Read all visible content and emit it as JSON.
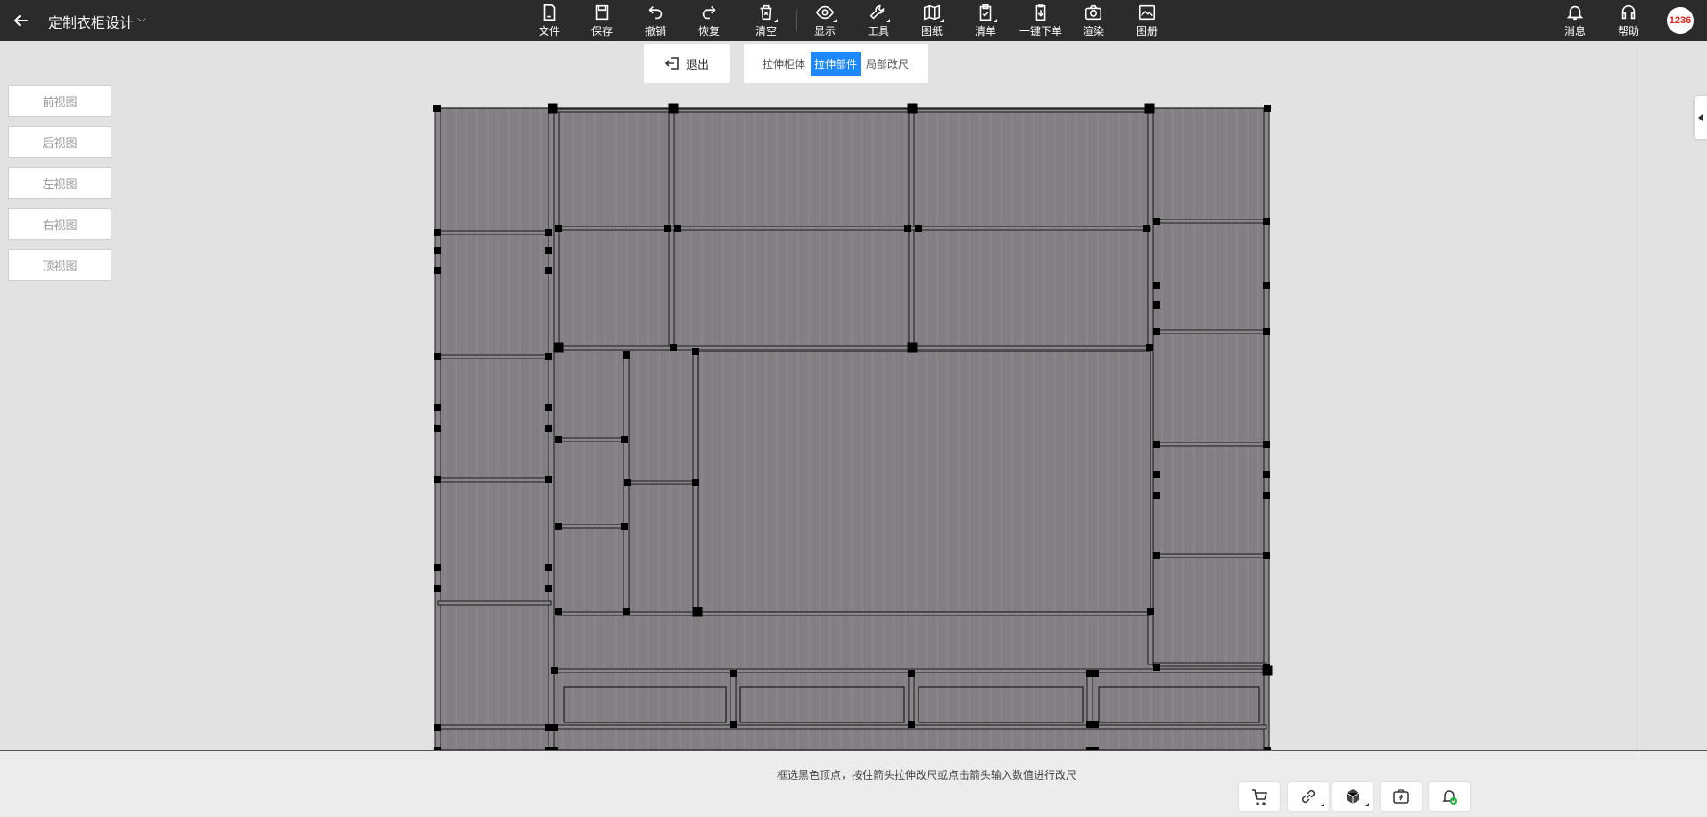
{
  "app": {
    "title": "定制衣柜设计"
  },
  "toolbar": [
    {
      "label": "文件",
      "icon": "file-icon",
      "dropdown": false
    },
    {
      "label": "保存",
      "icon": "save-icon",
      "dropdown": false
    },
    {
      "label": "撤销",
      "icon": "undo-icon",
      "dropdown": false
    },
    {
      "label": "恢复",
      "icon": "redo-icon",
      "dropdown": false
    },
    {
      "label": "清空",
      "icon": "clear-icon",
      "dropdown": true
    },
    {
      "label": "显示",
      "icon": "eye-icon",
      "dropdown": true
    },
    {
      "label": "工具",
      "icon": "wrench-icon",
      "dropdown": true
    },
    {
      "label": "图纸",
      "icon": "map-icon",
      "dropdown": true
    },
    {
      "label": "清单",
      "icon": "clipboard-icon",
      "dropdown": true
    },
    {
      "label": "一键下单",
      "icon": "order-icon",
      "dropdown": false
    },
    {
      "label": "渲染",
      "icon": "camera-icon",
      "dropdown": false
    },
    {
      "label": "图册",
      "icon": "album-icon",
      "dropdown": false
    }
  ],
  "right_toolbar": [
    {
      "label": "消息",
      "icon": "bell-icon"
    },
    {
      "label": "帮助",
      "icon": "headset-icon"
    }
  ],
  "user": {
    "avatar_text": "1236"
  },
  "exit_panel": {
    "label": "退出"
  },
  "stretch_modes": [
    {
      "label": "拉伸柜体",
      "active": false
    },
    {
      "label": "拉伸部件",
      "active": true
    },
    {
      "label": "局部改尺",
      "active": false
    }
  ],
  "views": [
    "前视图",
    "后视图",
    "左视图",
    "右视图",
    "顶视图"
  ],
  "hint": "框选黑色顶点，按住箭头拉伸改尺或点击箭头输入数值进行改尺",
  "bottom_icons": [
    "cart-icon",
    "link-icon",
    "cube-icon",
    "camera-flash-icon",
    "bell-check-icon"
  ],
  "colors": {
    "panel": "#858085",
    "active": "#1e88ff",
    "topbar": "#2b2b2b"
  }
}
